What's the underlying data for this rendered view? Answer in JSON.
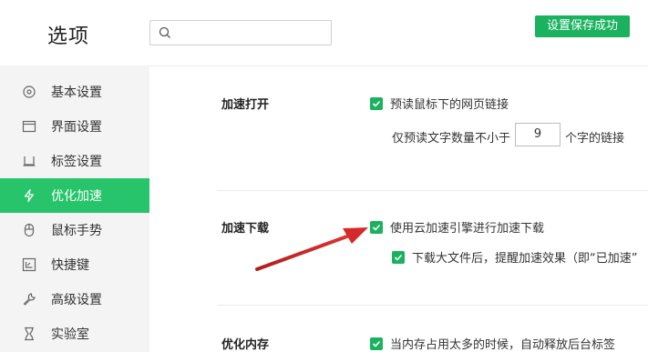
{
  "header": {
    "title": "选项",
    "search_placeholder": "",
    "save_badge": "设置保存成功"
  },
  "sidebar": {
    "items": [
      {
        "label": "基本设置",
        "icon": "target-icon"
      },
      {
        "label": "界面设置",
        "icon": "window-icon"
      },
      {
        "label": "标签设置",
        "icon": "tab-icon"
      },
      {
        "label": "优化加速",
        "icon": "lightning-icon",
        "active": true
      },
      {
        "label": "鼠标手势",
        "icon": "mouse-icon"
      },
      {
        "label": "快捷键",
        "icon": "keyboard-icon"
      },
      {
        "label": "高级设置",
        "icon": "wrench-icon"
      },
      {
        "label": "实验室",
        "icon": "flask-icon"
      }
    ]
  },
  "sections": {
    "accelerate_open": {
      "title": "加速打开",
      "prefetch_label": "预读鼠标下的网页链接",
      "min_chars_prefix": "仅预读文字数量不小于",
      "min_chars_value": "9",
      "min_chars_suffix": "个字的链接"
    },
    "accelerate_download": {
      "title": "加速下载",
      "cloud_label": "使用云加速引擎进行加速下载",
      "notify_label": "下载大文件后，提醒加速效果（即“已加速”"
    },
    "optimize_memory": {
      "title": "优化内存",
      "release_label": "当内存占用太多的时候，自动释放后台标签"
    }
  },
  "colors": {
    "accent": "#1bb25f",
    "active_item": "#27c46b",
    "arrow": "#d42a2a"
  }
}
